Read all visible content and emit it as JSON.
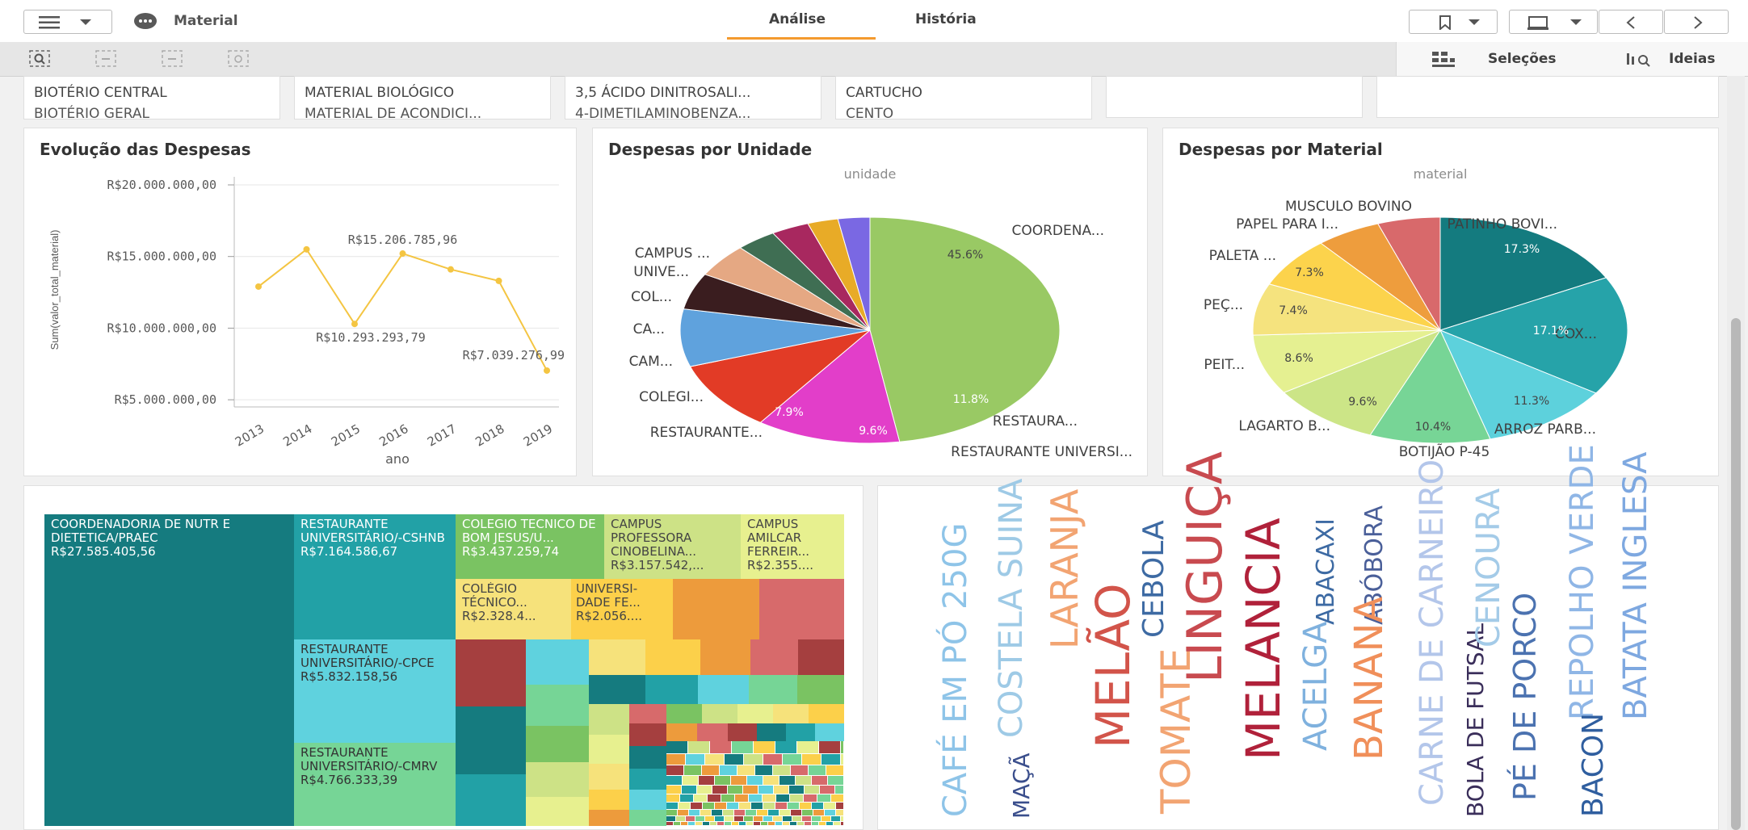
{
  "app": {
    "menu_icon": "hamburger-icon",
    "app_icon": "app-dots-icon",
    "title": "Material"
  },
  "tabs": [
    {
      "label": "Análise",
      "active": true
    },
    {
      "label": "História",
      "active": false
    }
  ],
  "toolbar": {
    "selections_label": "Seleções",
    "insights_label": "Ideias"
  },
  "filters": [
    {
      "row1": "BIOTÉRIO CENTRAL",
      "row2": "BIOTÉRIO GERAL"
    },
    {
      "row1": "MATERIAL BIOLÓGICO",
      "row2": "MATERIAL DE ACONDICI..."
    },
    {
      "row1": "3,5 ÁCIDO DINITROSALI...",
      "row2": "4-DIMETILAMINOBENZA..."
    },
    {
      "row1": "CARTUCHO",
      "row2": "CENTO"
    },
    {
      "row1": "",
      "row2": ""
    },
    {
      "row1": "",
      "row2": ""
    }
  ],
  "line_panel": {
    "title": "Evolução das Despesas",
    "chart_data": {
      "type": "line",
      "x": [
        "2013",
        "2014",
        "2015",
        "2016",
        "2017",
        "2018",
        "2019"
      ],
      "values": [
        12900000,
        15500000,
        10293293.79,
        15206785.96,
        14100000,
        13300000,
        7039276.99
      ],
      "ylabel": "Sum(valor_total_material)",
      "xlabel": "ano",
      "yticks": [
        "R$20.000.000,00",
        "R$15.000.000,00",
        "R$10.000.000,00",
        "R$5.000.000,00"
      ],
      "annotations": [
        "R$15.206.785,96",
        "R$10.293.293,79",
        "R$7.039.276,99"
      ],
      "color": "#f4c542"
    }
  },
  "pie_unit": {
    "title": "Despesas por Unidade",
    "chart_data": {
      "type": "pie",
      "dimension": "unidade",
      "slices": [
        {
          "label": "COORDENA...",
          "value": 45.6,
          "pct": "45.6%",
          "color": "#99c964"
        },
        {
          "label": "RESTAURA...",
          "value": 11.8,
          "pct": "11.8%",
          "color": "#e23ec9"
        },
        {
          "label": "RESTAURANTE UNIVERSI...",
          "value": 9.6,
          "pct": "9.6%",
          "color": "#e23b26"
        },
        {
          "label": "RESTAURANTE...",
          "value": 7.9,
          "pct": "7.9%",
          "color": "#5fa2dd"
        },
        {
          "label": "COLEGI...",
          "value": 5.0,
          "pct": "",
          "color": "#3a1d1f"
        },
        {
          "label": "CAM...",
          "value": 4.6,
          "pct": "",
          "color": "#e5a883"
        },
        {
          "label": "CA...",
          "value": 3.3,
          "pct": "",
          "color": "#3f6e53"
        },
        {
          "label": "COL...",
          "value": 3.1,
          "pct": "",
          "color": "#a8285f"
        },
        {
          "label": "UNIVE...",
          "value": 2.5,
          "pct": "",
          "color": "#e8ab27"
        },
        {
          "label": "CAMPUS ...",
          "value": 2.6,
          "pct": "",
          "color": "#7a68e3"
        }
      ]
    }
  },
  "pie_material": {
    "title": "Despesas por Material",
    "chart_data": {
      "type": "pie",
      "dimension": "material",
      "slices": [
        {
          "label": "PATINHO BOVI...",
          "value": 17.3,
          "pct": "17.3%",
          "color": "#147b7f"
        },
        {
          "label": "COX...",
          "value": 17.1,
          "pct": "17.1%",
          "color": "#26a3a9"
        },
        {
          "label": "ARROZ PARB...",
          "value": 11.3,
          "pct": "11.3%",
          "color": "#5dd1dc"
        },
        {
          "label": "BOTIJÃO P-45",
          "value": 10.4,
          "pct": "10.4%",
          "color": "#77d596"
        },
        {
          "label": "LAGARTO B...",
          "value": 9.6,
          "pct": "9.6%",
          "color": "#cce587"
        },
        {
          "label": "PEIT...",
          "value": 8.6,
          "pct": "8.6%",
          "color": "#e5f091"
        },
        {
          "label": "PEÇ...",
          "value": 7.4,
          "pct": "7.4%",
          "color": "#f5e37e"
        },
        {
          "label": "PALETA ...",
          "value": 7.3,
          "pct": "7.3%",
          "color": "#fcd34c"
        },
        {
          "label": "PAPEL PARA I...",
          "value": 5.6,
          "pct": "",
          "color": "#ee9d3d"
        },
        {
          "label": "MUSCULO BOVINO",
          "value": 5.4,
          "pct": "",
          "color": "#d8696b"
        }
      ]
    }
  },
  "treemap": {
    "tiles": [
      {
        "name": "COORDENADORIA DE NUTR E DIETETICA/PRAEC",
        "value": "R$27.585.405,56"
      },
      {
        "name": "RESTAURANTE UNIVERSITÁRIO/-CSHNB",
        "value": "R$7.164.586,67"
      },
      {
        "name": "RESTAURANTE UNIVERSITÁRIO/-CPCE",
        "value": "R$5.832.158,56"
      },
      {
        "name": "RESTAURANTE UNIVERSITÁRIO/-CMRV",
        "value": "R$4.766.333,39"
      },
      {
        "name": "COLEGIO TECNICO DE BOM JESUS/U...",
        "value": "R$3.437.259,74"
      },
      {
        "name": "CAMPUS PROFESSORA CINOBELINA...",
        "value": "R$3.157.542,..."
      },
      {
        "name": "CAMPUS AMILCAR FERREIR...",
        "value": "R$2.355...."
      },
      {
        "name": "COLÉGIO TÉCNICO...",
        "value": "R$2.328.4..."
      },
      {
        "name": "UNIVERSI-DADE FE...",
        "value": "R$2.056...."
      }
    ]
  },
  "wordcloud": {
    "words": [
      {
        "text": "CAFÉ EM PÓ 250G",
        "color": "#8ec4e8"
      },
      {
        "text": "COSTELA SUINA",
        "color": "#9ecae6"
      },
      {
        "text": "MAÇÃ",
        "color": "#3a4e8c"
      },
      {
        "text": "LARANJA",
        "color": "#f2a472"
      },
      {
        "text": "MELÃO",
        "color": "#d2544a"
      },
      {
        "text": "CEBOLA",
        "color": "#3d6aa3"
      },
      {
        "text": "TOMATE",
        "color": "#f2a472"
      },
      {
        "text": "LINGUIÇA",
        "color": "#c84a4f"
      },
      {
        "text": "MELANCIA",
        "color": "#b0213a"
      },
      {
        "text": "ABACAXI",
        "color": "#3d6aa3"
      },
      {
        "text": "ACELGA",
        "color": "#7fb1de"
      },
      {
        "text": "ABÓBORA",
        "color": "#4a5f99"
      },
      {
        "text": "BANANA",
        "color": "#f08f5a"
      },
      {
        "text": "CARNE DE CARNEIRO",
        "color": "#b3c6ea"
      },
      {
        "text": "BOLA DE FUTSAL",
        "color": "#3a2e5a"
      },
      {
        "text": "CENOURA",
        "color": "#a4cbe8"
      },
      {
        "text": "PÉ DE PORCO",
        "color": "#4b72b0"
      },
      {
        "text": "REPOLHO VERDE",
        "color": "#8fb6e6"
      },
      {
        "text": "BACON",
        "color": "#2f5e9f"
      },
      {
        "text": "BATATA INGLESA",
        "color": "#7ea8e0"
      }
    ]
  }
}
